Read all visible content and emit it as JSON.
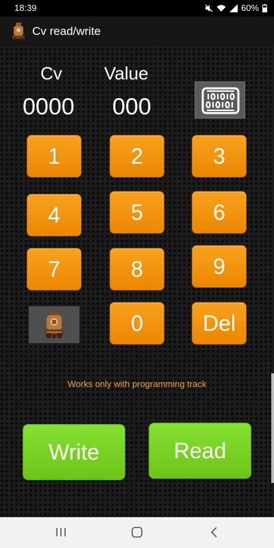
{
  "status": {
    "time": "18:39",
    "battery": "60%"
  },
  "appbar": {
    "title": "Cv read/write",
    "icon": "locomotive-icon"
  },
  "display": {
    "cv_label": "Cv",
    "cv_value": "0000",
    "value_label": "Value",
    "value_value": "000",
    "binary_button_icon": "binary-icon"
  },
  "keypad": {
    "k1": "1",
    "k2": "2",
    "k3": "3",
    "k4": "4",
    "k5": "5",
    "k6": "6",
    "k7": "7",
    "k8": "8",
    "k9": "9",
    "k0": "0",
    "del": "Del",
    "loco_icon": "locomotive-icon"
  },
  "note": "Works only with programming track",
  "actions": {
    "write": "Write",
    "read": "Read"
  },
  "colors": {
    "key": "#f39200",
    "action": "#7ad225",
    "note": "#f0a030"
  }
}
